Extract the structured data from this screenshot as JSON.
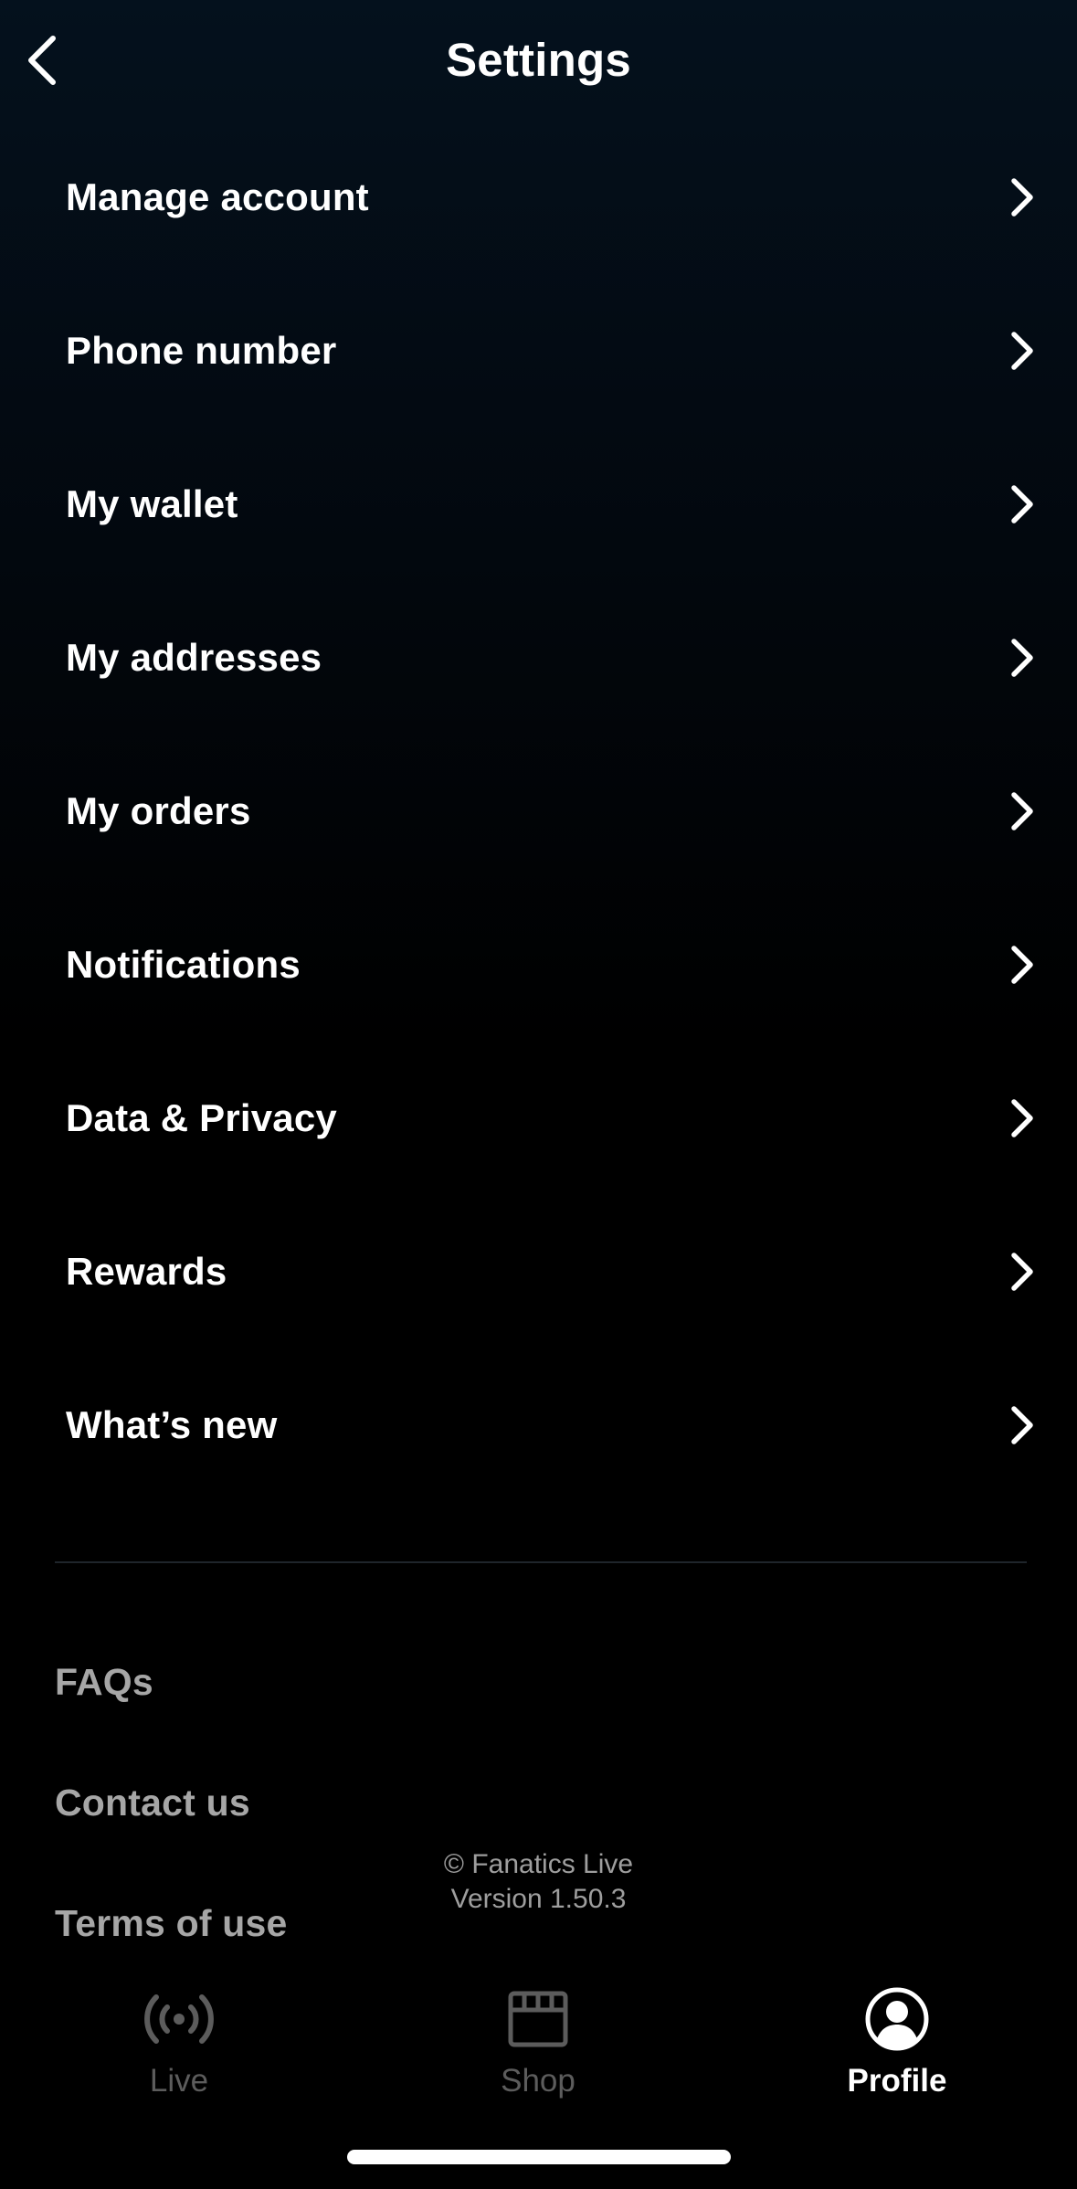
{
  "header": {
    "title": "Settings",
    "back_icon": "chevron-left-icon"
  },
  "menu": {
    "items": [
      {
        "id": "manage-account",
        "label": "Manage account"
      },
      {
        "id": "phone-number",
        "label": "Phone number"
      },
      {
        "id": "my-wallet",
        "label": "My wallet"
      },
      {
        "id": "my-addresses",
        "label": "My addresses"
      },
      {
        "id": "my-orders",
        "label": "My orders"
      },
      {
        "id": "notifications",
        "label": "Notifications"
      },
      {
        "id": "data-privacy",
        "label": "Data & Privacy"
      },
      {
        "id": "rewards",
        "label": "Rewards"
      },
      {
        "id": "whats-new",
        "label": "What’s new"
      }
    ],
    "chevron_icon": "chevron-right-icon"
  },
  "links": {
    "faqs": "FAQs",
    "contact": "Contact us",
    "terms": "Terms of use"
  },
  "footer": {
    "copyright": "© Fanatics Live",
    "version": "Version 1.50.3"
  },
  "tabbar": {
    "tabs": [
      {
        "label": "Live",
        "icon": "broadcast-icon",
        "active": false
      },
      {
        "label": "Shop",
        "icon": "storefront-icon",
        "active": false
      },
      {
        "label": "Profile",
        "icon": "profile-icon",
        "active": true
      }
    ]
  },
  "colors": {
    "text_primary": "#ffffff",
    "text_secondary": "#a6a6a6",
    "tab_inactive": "#5c5c5c",
    "divider": "#1f252b"
  }
}
